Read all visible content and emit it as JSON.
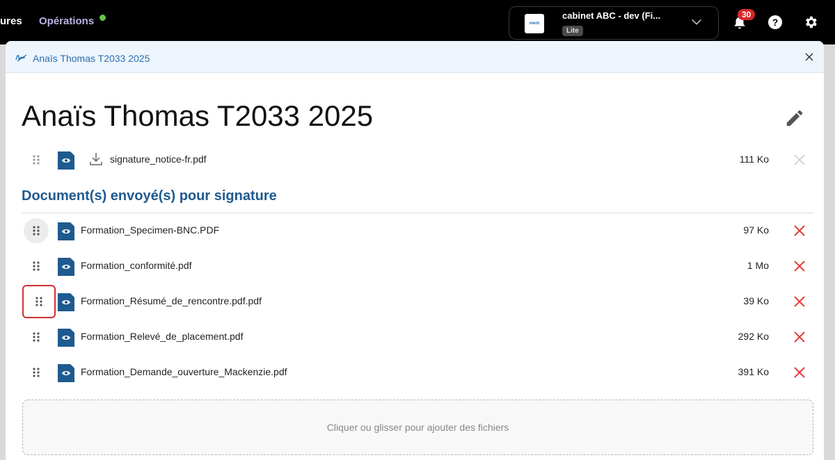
{
  "topnav": {
    "partial_item": "ures",
    "operations": "Opérations"
  },
  "org": {
    "logo_text": "ment",
    "name": "cabinet ABC - dev (Fi...",
    "plan": "Lite"
  },
  "notifications": {
    "count": "30"
  },
  "help": {
    "label": "?"
  },
  "panel": {
    "header_title": "Anaïs Thomas T2033 2025",
    "title": "Anaïs Thomas T2033 2025"
  },
  "notice_file": {
    "name": "signature_notice-fr.pdf",
    "size": "111 Ko"
  },
  "section": {
    "title": "Document(s) envoyé(s) pour signature"
  },
  "files": [
    {
      "name": "Formation_Specimen-BNC.PDF",
      "size": "97 Ko"
    },
    {
      "name": "Formation_conformité.pdf",
      "size": "1 Mo"
    },
    {
      "name": "Formation_Résumé_de_rencontre.pdf.pdf",
      "size": "39 Ko"
    },
    {
      "name": "Formation_Relevé_de_placement.pdf",
      "size": "292 Ko"
    },
    {
      "name": "Formation_Demande_ouverture_Mackenzie.pdf",
      "size": "391 Ko"
    }
  ],
  "dropzone": {
    "label": "Cliquer ou glisser pour ajouter des fichiers"
  },
  "colors": {
    "accent": "#1f5a8f",
    "delete": "#e53935",
    "badge": "#d9262b",
    "status_dot": "#6cc14c"
  }
}
